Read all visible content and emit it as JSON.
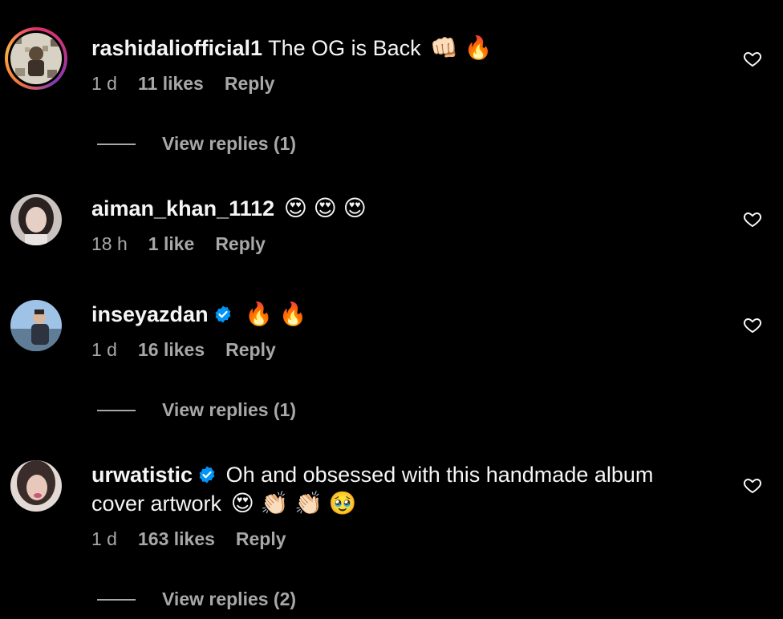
{
  "comments": [
    {
      "username": "rashidaliofficial1",
      "verified": false,
      "text": "The OG is Back",
      "emoji": "👊🏻 🔥",
      "time": "1 d",
      "likes": "11 likes",
      "reply": "Reply",
      "view_replies": "View replies (1)"
    },
    {
      "username": "aiman_khan_1112",
      "verified": false,
      "text": "",
      "emoji": "😍 😍 😍",
      "time": "18 h",
      "likes": "1 like",
      "reply": "Reply",
      "view_replies": ""
    },
    {
      "username": "inseyazdan",
      "verified": true,
      "text": "",
      "emoji": "🔥 🔥",
      "time": "1 d",
      "likes": "16 likes",
      "reply": "Reply",
      "view_replies": "View replies (1)"
    },
    {
      "username": "urwatistic",
      "verified": true,
      "text": "Oh and obsessed with this handmade album",
      "text2": "cover artwork",
      "emoji": "😍 👏🏻 👏🏻 🥹",
      "time": "1 d",
      "likes": "163 likes",
      "reply": "Reply",
      "view_replies": "View replies (2)"
    }
  ],
  "colors": {
    "background": "#000000",
    "text": "#f5f5f5",
    "secondary": "#a8a8a8",
    "verified": "#0095f6"
  }
}
